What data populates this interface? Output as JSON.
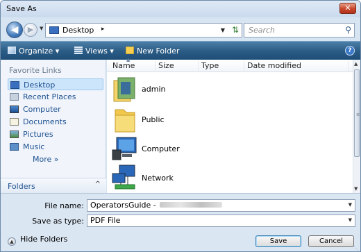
{
  "window": {
    "title": "Save As",
    "close_label": "✕"
  },
  "address": {
    "location": "Desktop",
    "separator": "▸",
    "search_placeholder": "Search"
  },
  "toolbar": {
    "organize": "Organize ▾",
    "views": "Views ▾",
    "new_folder": "New Folder",
    "help": "?"
  },
  "nav": {
    "favorite_links_title": "Favorite Links",
    "items": [
      {
        "label": "Desktop",
        "icon": "desktop-icon",
        "selected": true
      },
      {
        "label": "Recent Places",
        "icon": "recent-places-icon"
      },
      {
        "label": "Computer",
        "icon": "computer-icon"
      },
      {
        "label": "Documents",
        "icon": "documents-icon"
      },
      {
        "label": "Pictures",
        "icon": "pictures-icon"
      },
      {
        "label": "Music",
        "icon": "music-icon"
      }
    ],
    "more_label": "More »",
    "folders_label": "Folders",
    "folders_caret": "^"
  },
  "filelist": {
    "columns": [
      "Name",
      "Size",
      "Type",
      "Date modified"
    ],
    "items": [
      {
        "name": "admin",
        "icon": "user-folder-icon"
      },
      {
        "name": "Public",
        "icon": "folder-icon"
      },
      {
        "name": "Computer",
        "icon": "computer-icon"
      },
      {
        "name": "Network",
        "icon": "network-icon"
      }
    ]
  },
  "bottom": {
    "filename_label": "File name:",
    "filename_value": "OperatorsGuide - ",
    "savetype_label": "Save as type:",
    "savetype_value": "PDF File",
    "hide_folders_label": "Hide Folders",
    "save_button": "Save",
    "cancel_button": "Cancel"
  },
  "colors": {
    "toolbar": "#2c5d86",
    "close_button": "#c7452a",
    "link_text": "#1c4f8f"
  }
}
